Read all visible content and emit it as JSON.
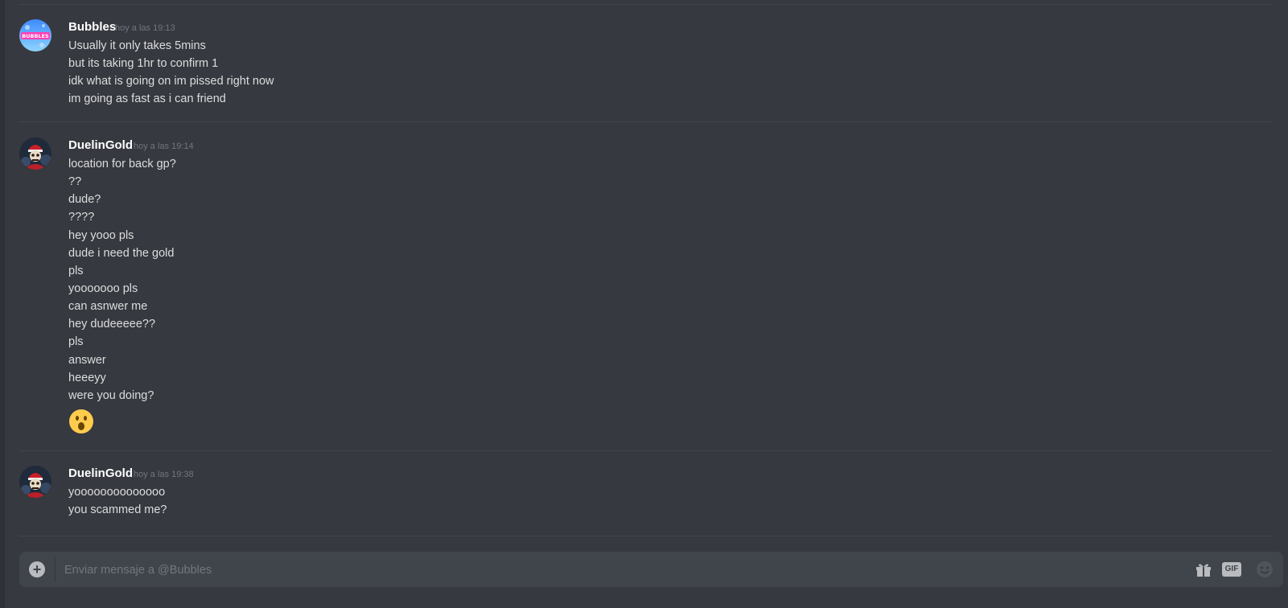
{
  "messages": [
    {
      "author": "Bubbles",
      "avatar_text": "BUBBLES",
      "timestamp": "hoy a las 19:13",
      "lines": [
        "Usually it only takes 5mins",
        "but its taking 1hr to confirm 1",
        "idk what is going on im pissed right now",
        "im going as fast as i can friend"
      ]
    },
    {
      "author": "DuelinGold",
      "timestamp": "hoy a las 19:14",
      "lines": [
        "location for back gp?",
        "??",
        "dude?",
        "????",
        "hey yooo pls",
        "dude i need the gold",
        "pls",
        "yooooooo pls",
        "can asnwer me",
        "hey dudeeeee??",
        "pls",
        "answer",
        "heeeyy",
        "were you doing?"
      ],
      "emoji": "open-mouth-emoji"
    },
    {
      "author": "DuelinGold",
      "timestamp": "hoy a las 19:38",
      "lines": [
        "yoooooooooooooo",
        "you scammed me?"
      ]
    }
  ],
  "composer": {
    "placeholder": "Enviar mensaje a @Bubbles",
    "gif_label": "GIF",
    "add_icon": "plus-circle-icon",
    "gift_icon": "gift-icon",
    "emoji_icon": "emoji-icon"
  },
  "colors": {
    "background": "#36393f",
    "composer_bg": "#40444b",
    "text": "#dcddde",
    "muted": "#72767d",
    "username": "#ffffff"
  }
}
